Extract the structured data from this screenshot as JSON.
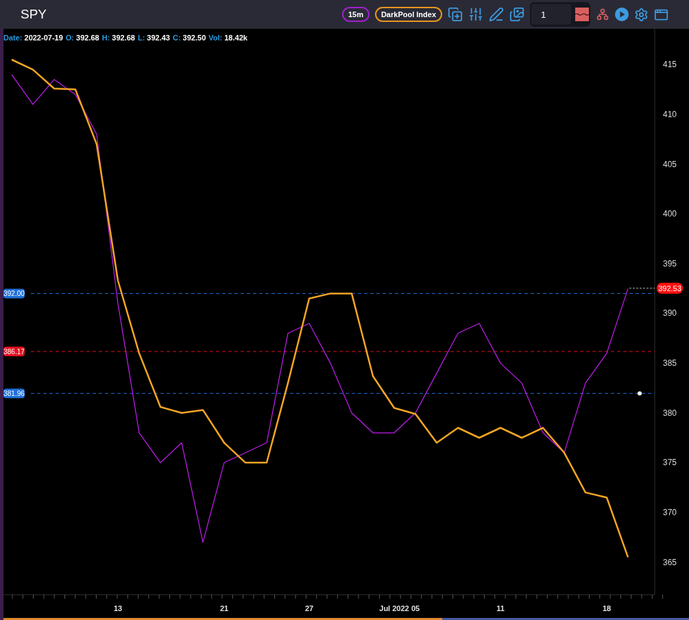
{
  "toolbar": {
    "symbol": "SPY",
    "pills": [
      {
        "label": "15m",
        "color": "#a21fd0"
      },
      {
        "label": "DarkPool Index",
        "color": "#e8961e"
      }
    ],
    "input": {
      "value": "1"
    }
  },
  "ohlc": [
    {
      "label": "Date:",
      "value": "2022-07-19"
    },
    {
      "label": "O:",
      "value": "392.68"
    },
    {
      "label": "H:",
      "value": "392.68"
    },
    {
      "label": "L:",
      "value": "392.43"
    },
    {
      "label": "C:",
      "value": "392.50"
    },
    {
      "label": "Vol:",
      "value": "18.42k"
    }
  ],
  "chart": {
    "chart_data": {
      "type": "line",
      "categories": [
        null,
        null,
        null,
        null,
        null,
        "13",
        null,
        null,
        null,
        null,
        "21",
        null,
        null,
        null,
        "27",
        null,
        null,
        null,
        "Jul 2022",
        "05",
        null,
        null,
        null,
        "11",
        null,
        null,
        null,
        null,
        "18",
        null
      ],
      "series": [
        {
          "color": "#c21ff0",
          "values": [
            414,
            411,
            413.5,
            412,
            408,
            391,
            378,
            375,
            377,
            367,
            375,
            376,
            377,
            388,
            389,
            385,
            380,
            378,
            378,
            380,
            384,
            388,
            389,
            385,
            383,
            378,
            376,
            383,
            386,
            392.5
          ]
        },
        {
          "color": "#f5a623",
          "values": [
            415.5,
            414.5,
            412.6,
            412.5,
            407,
            393.3,
            386,
            380.6,
            380,
            380.3,
            377,
            375,
            375,
            383,
            391.5,
            392,
            392,
            383.7,
            380.5,
            379.9,
            377,
            378.5,
            377.5,
            378.5,
            377.5,
            378.5,
            376,
            372,
            371.5,
            365.5
          ]
        }
      ],
      "ylim": [
        361.6,
        418.6
      ],
      "yticks": [
        365,
        370,
        375,
        380,
        385,
        390,
        395,
        400,
        405,
        410,
        415
      ],
      "ref_lines": [
        {
          "axis": "y",
          "value": 392.0,
          "label": "392.00",
          "color": "#1f6fd8"
        },
        {
          "axis": "y",
          "value": 386.17,
          "label": "386.17",
          "color": "#e0101e"
        },
        {
          "axis": "y",
          "value": 381.96,
          "label": "381.96",
          "color": "#1f6fd8"
        }
      ]
    },
    "last_price": {
      "label": "392.53"
    }
  }
}
